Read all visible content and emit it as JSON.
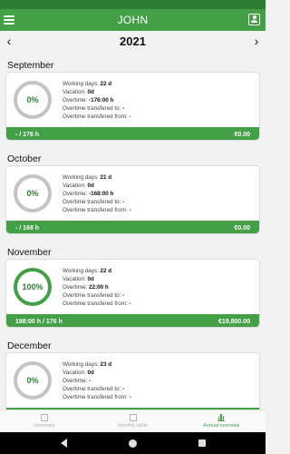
{
  "app": {
    "title": "JOHN"
  },
  "year": {
    "value": "2021",
    "prev_label": "‹",
    "next_label": "›"
  },
  "labels": {
    "working_days": "Working days:",
    "vacation": "Vacation:",
    "overtime": "Overtime:",
    "transferred_to": "Overtime transfered to:",
    "transferred_from": "Overtime transfered from:"
  },
  "months": [
    {
      "name": "September",
      "percent": "0%",
      "working_days": "22 d",
      "vacation": "0d",
      "overtime": "-176:00 h",
      "transferred_to": "-",
      "transferred_from": "-",
      "hours": "- / 176 h",
      "amount": "€0.00",
      "progress": 0
    },
    {
      "name": "October",
      "percent": "0%",
      "working_days": "21 d",
      "vacation": "0d",
      "overtime": "-168:00 h",
      "transferred_to": "-",
      "transferred_from": "-",
      "hours": "- / 168 h",
      "amount": "€0.00",
      "progress": 0
    },
    {
      "name": "November",
      "percent": "100%",
      "working_days": "22 d",
      "vacation": "0d",
      "overtime": "22:00 h",
      "transferred_to": "-",
      "transferred_from": "-",
      "hours": "198:00 h / 176 h",
      "amount": "€19,800.00",
      "progress": 1
    },
    {
      "name": "December",
      "percent": "0%",
      "working_days": "23 d",
      "vacation": "0d",
      "overtime": "-",
      "transferred_to": "-",
      "transferred_from": "-",
      "hours": "",
      "amount": "",
      "progress": 0
    }
  ],
  "bottom_nav": [
    {
      "label": "Summary",
      "icon": "summary-icon",
      "active": false
    },
    {
      "label": "Monthly table",
      "icon": "table-icon",
      "active": false
    },
    {
      "label": "Annual overview",
      "icon": "bar-chart-icon",
      "active": true
    }
  ],
  "colors": {
    "primary": "#43a047",
    "primary_dark": "#2e7d32",
    "ring_empty": "#c4c4c4"
  }
}
